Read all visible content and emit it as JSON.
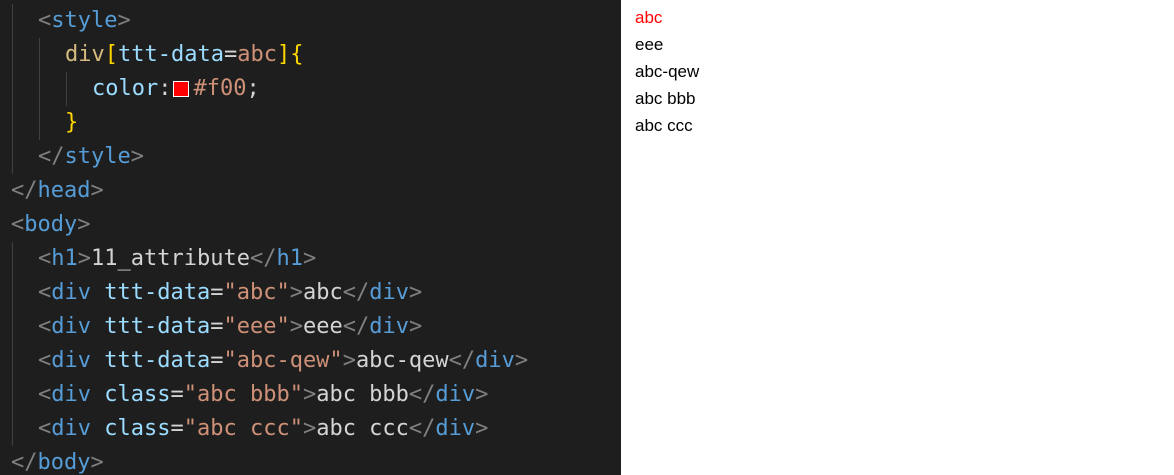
{
  "colors": {
    "editor_bg": "#1e1e1e",
    "swatch": "#ff0000",
    "red_text": "#ff0000"
  },
  "editor": {
    "lines": [
      {
        "indent": 2,
        "tokens": [
          {
            "t": "<",
            "c": "punct"
          },
          {
            "t": "style",
            "c": "tag"
          },
          {
            "t": ">",
            "c": "punct"
          }
        ]
      },
      {
        "indent": 4,
        "tokens": [
          {
            "t": "div",
            "c": "sel"
          },
          {
            "t": "[",
            "c": "brace"
          },
          {
            "t": "ttt-data",
            "c": "attr"
          },
          {
            "t": "=",
            "c": "text"
          },
          {
            "t": "abc",
            "c": "str"
          },
          {
            "t": "]",
            "c": "brace"
          },
          {
            "t": "{",
            "c": "brace"
          }
        ]
      },
      {
        "indent": 6,
        "tokens": [
          {
            "t": "color",
            "c": "attr"
          },
          {
            "t": ":",
            "c": "text"
          },
          {
            "t": "",
            "c": "swatch"
          },
          {
            "t": "#f00",
            "c": "str"
          },
          {
            "t": ";",
            "c": "text"
          }
        ]
      },
      {
        "indent": 4,
        "tokens": [
          {
            "t": "}",
            "c": "brace"
          }
        ]
      },
      {
        "indent": 2,
        "tokens": [
          {
            "t": "</",
            "c": "punct"
          },
          {
            "t": "style",
            "c": "tag"
          },
          {
            "t": ">",
            "c": "punct"
          }
        ]
      },
      {
        "indent": 0,
        "tokens": [
          {
            "t": "</",
            "c": "punct"
          },
          {
            "t": "head",
            "c": "tag"
          },
          {
            "t": ">",
            "c": "punct"
          }
        ]
      },
      {
        "indent": 0,
        "tokens": [
          {
            "t": "<",
            "c": "punct"
          },
          {
            "t": "body",
            "c": "tag"
          },
          {
            "t": ">",
            "c": "punct"
          }
        ]
      },
      {
        "indent": 2,
        "tokens": [
          {
            "t": "<",
            "c": "punct"
          },
          {
            "t": "h1",
            "c": "tag"
          },
          {
            "t": ">",
            "c": "punct"
          },
          {
            "t": "11_attribute",
            "c": "text"
          },
          {
            "t": "</",
            "c": "punct"
          },
          {
            "t": "h1",
            "c": "tag"
          },
          {
            "t": ">",
            "c": "punct"
          }
        ]
      },
      {
        "indent": 2,
        "tokens": [
          {
            "t": "<",
            "c": "punct"
          },
          {
            "t": "div",
            "c": "tag"
          },
          {
            "t": " ",
            "c": "text"
          },
          {
            "t": "ttt-data",
            "c": "attr"
          },
          {
            "t": "=",
            "c": "text"
          },
          {
            "t": "\"abc\"",
            "c": "str"
          },
          {
            "t": ">",
            "c": "punct"
          },
          {
            "t": "abc",
            "c": "text"
          },
          {
            "t": "</",
            "c": "punct"
          },
          {
            "t": "div",
            "c": "tag"
          },
          {
            "t": ">",
            "c": "punct"
          }
        ]
      },
      {
        "indent": 2,
        "tokens": [
          {
            "t": "<",
            "c": "punct"
          },
          {
            "t": "div",
            "c": "tag"
          },
          {
            "t": " ",
            "c": "text"
          },
          {
            "t": "ttt-data",
            "c": "attr"
          },
          {
            "t": "=",
            "c": "text"
          },
          {
            "t": "\"eee\"",
            "c": "str"
          },
          {
            "t": ">",
            "c": "punct"
          },
          {
            "t": "eee",
            "c": "text"
          },
          {
            "t": "</",
            "c": "punct"
          },
          {
            "t": "div",
            "c": "tag"
          },
          {
            "t": ">",
            "c": "punct"
          }
        ]
      },
      {
        "indent": 2,
        "tokens": [
          {
            "t": "<",
            "c": "punct"
          },
          {
            "t": "div",
            "c": "tag"
          },
          {
            "t": " ",
            "c": "text"
          },
          {
            "t": "ttt-data",
            "c": "attr"
          },
          {
            "t": "=",
            "c": "text"
          },
          {
            "t": "\"abc-qew\"",
            "c": "str"
          },
          {
            "t": ">",
            "c": "punct"
          },
          {
            "t": "abc-qew",
            "c": "text"
          },
          {
            "t": "</",
            "c": "punct"
          },
          {
            "t": "div",
            "c": "tag"
          },
          {
            "t": ">",
            "c": "punct"
          }
        ]
      },
      {
        "indent": 2,
        "tokens": [
          {
            "t": "<",
            "c": "punct"
          },
          {
            "t": "div",
            "c": "tag"
          },
          {
            "t": " ",
            "c": "text"
          },
          {
            "t": "class",
            "c": "attr"
          },
          {
            "t": "=",
            "c": "text"
          },
          {
            "t": "\"abc bbb\"",
            "c": "str"
          },
          {
            "t": ">",
            "c": "punct"
          },
          {
            "t": "abc bbb",
            "c": "text"
          },
          {
            "t": "</",
            "c": "punct"
          },
          {
            "t": "div",
            "c": "tag"
          },
          {
            "t": ">",
            "c": "punct"
          }
        ]
      },
      {
        "indent": 2,
        "tokens": [
          {
            "t": "<",
            "c": "punct"
          },
          {
            "t": "div",
            "c": "tag"
          },
          {
            "t": " ",
            "c": "text"
          },
          {
            "t": "class",
            "c": "attr"
          },
          {
            "t": "=",
            "c": "text"
          },
          {
            "t": "\"abc ccc\"",
            "c": "str"
          },
          {
            "t": ">",
            "c": "punct"
          },
          {
            "t": "abc ccc",
            "c": "text"
          },
          {
            "t": "</",
            "c": "punct"
          },
          {
            "t": "div",
            "c": "tag"
          },
          {
            "t": ">",
            "c": "punct"
          }
        ]
      },
      {
        "indent": 0,
        "tokens": [
          {
            "t": "</",
            "c": "punct"
          },
          {
            "t": "body",
            "c": "tag"
          },
          {
            "t": ">",
            "c": "punct"
          }
        ]
      }
    ]
  },
  "preview": {
    "items": [
      {
        "text": "abc",
        "color": "#ff0000"
      },
      {
        "text": "eee",
        "color": "#000000"
      },
      {
        "text": "abc-qew",
        "color": "#000000"
      },
      {
        "text": "abc bbb",
        "color": "#000000"
      },
      {
        "text": "abc ccc",
        "color": "#000000"
      }
    ]
  }
}
